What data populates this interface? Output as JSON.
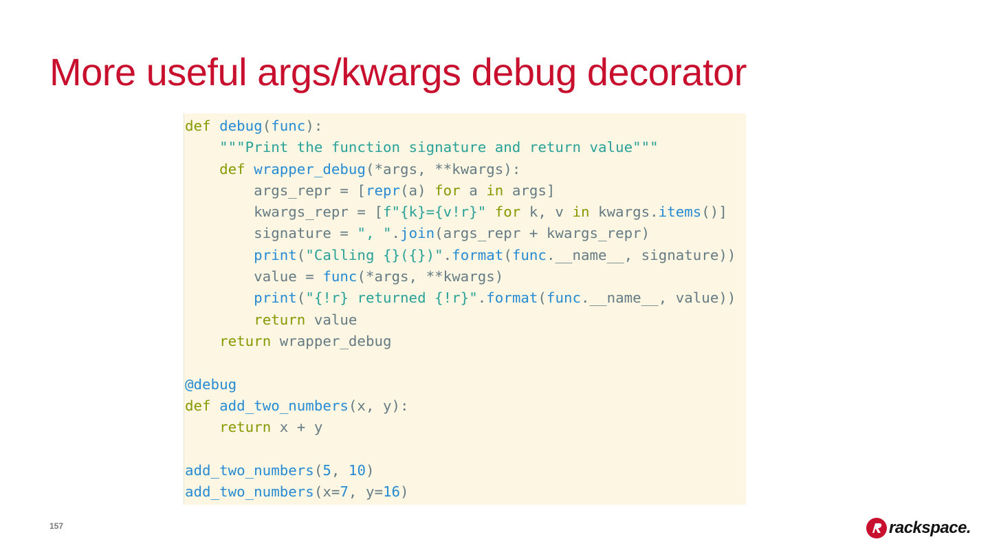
{
  "slide": {
    "title": "More useful args/kwargs debug decorator",
    "page_number": "157",
    "brand": {
      "name": "rackspace.",
      "color": "#c8102e"
    }
  },
  "code": {
    "language": "python",
    "background": "#fdf6e3",
    "lines": [
      "def debug(func):",
      "    \"\"\"Print the function signature and return value\"\"\"",
      "    def wrapper_debug(*args, **kwargs):",
      "        args_repr = [repr(a) for a in args]",
      "        kwargs_repr = [f\"{k}={v!r}\" for k, v in kwargs.items()]",
      "        signature = \", \".join(args_repr + kwargs_repr)",
      "        print(\"Calling {}({})\".format(func.__name__, signature))",
      "        value = func(*args, **kwargs)",
      "        print(\"{!r} returned {!r}\".format(func.__name__, value))",
      "        return value",
      "    return wrapper_debug",
      "",
      "@debug",
      "def add_two_numbers(x, y):",
      "    return x + y",
      "",
      "add_two_numbers(5, 10)",
      "add_two_numbers(x=7, y=16)"
    ]
  }
}
